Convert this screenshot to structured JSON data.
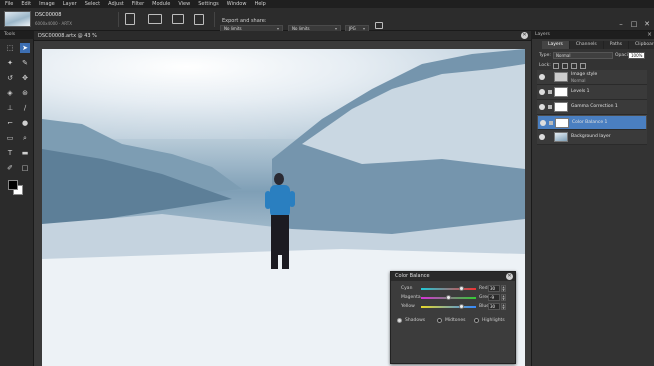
{
  "menu": [
    "File",
    "Edit",
    "Image",
    "Layer",
    "Select",
    "Adjust",
    "Filter",
    "Module",
    "View",
    "Settings",
    "Window",
    "Help"
  ],
  "file": {
    "name": "DSC00008",
    "meta": "6000x4000 · ARTX"
  },
  "export": {
    "label": "Export and share:",
    "size_left": "No limits",
    "size_right": "No limits",
    "format": "JPG"
  },
  "tools_title": "Tools",
  "document": {
    "tab_title": "DSC00008.artx @ 43 %"
  },
  "color_balance": {
    "title": "Color Balance",
    "rows": [
      {
        "left": "Cyan",
        "right": "Red",
        "value": "30",
        "fraction": 0.73,
        "gradient": "linear-gradient(90deg,#21c9d6,#e33)"
      },
      {
        "left": "Magenta",
        "right": "Green",
        "value": "-9",
        "fraction": 0.5,
        "gradient": "linear-gradient(90deg,#d632d6,#3c3)"
      },
      {
        "left": "Yellow",
        "right": "Blue",
        "value": "30",
        "fraction": 0.73,
        "gradient": "linear-gradient(90deg,#e8d82a,#38f)"
      }
    ],
    "tones": [
      "Shadows",
      "Midtones",
      "Highlights"
    ],
    "selected_tone": "Shadows"
  },
  "layers_title": "Layers",
  "layers_tabs": [
    "Layers",
    "Channels",
    "Paths",
    "Clipboard"
  ],
  "layers_controls": {
    "type_label": "Type:",
    "blend_mode": "Normal",
    "opacity_label": "Opacity:",
    "opacity_value": "100%",
    "lock_label": "Lock:"
  },
  "layers": [
    {
      "name": "Image style",
      "sub": "Normal",
      "selected": false
    },
    {
      "name": "Levels 1",
      "sub": "",
      "selected": false
    },
    {
      "name": "Gamma Correction 1",
      "sub": "",
      "selected": false
    },
    {
      "name": "Color Balance 1",
      "sub": "",
      "selected": true
    },
    {
      "name": "Background layer",
      "sub": "",
      "selected": false
    }
  ]
}
